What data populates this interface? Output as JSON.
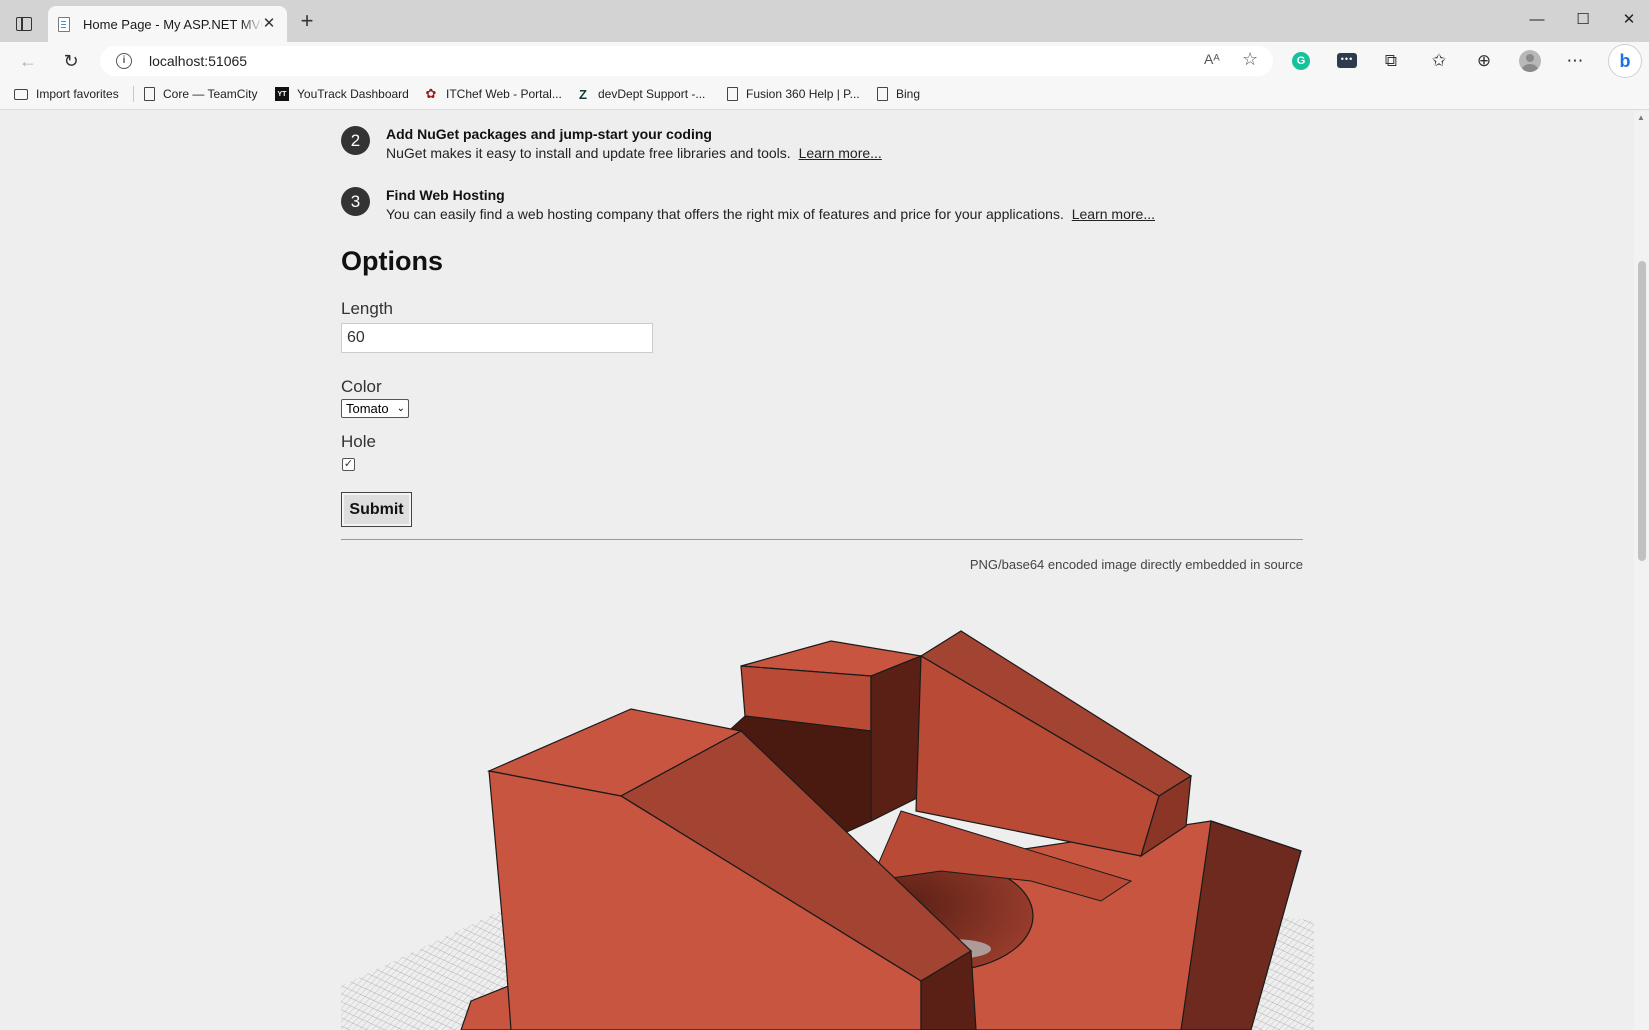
{
  "browser": {
    "tab_title": "Home Page - My ASP.NET MVC Application",
    "url": "localhost:51065",
    "bookmarks": [
      {
        "label": "Import favorites",
        "icon": "folder-icon"
      },
      {
        "label": "Core — TeamCity",
        "icon": "page-icon"
      },
      {
        "label": "YouTrack Dashboard",
        "icon": "youtrack-icon"
      },
      {
        "label": "ITChef Web - Portal...",
        "icon": "itchef-icon"
      },
      {
        "label": "devDept Support -...",
        "icon": "zendesk-icon"
      },
      {
        "label": "Fusion 360 Help | P...",
        "icon": "page-icon"
      },
      {
        "label": "Bing",
        "icon": "page-icon"
      }
    ]
  },
  "steps": [
    {
      "number": "2",
      "heading": "Add NuGet packages and jump-start your coding",
      "description": "NuGet makes it easy to install and update free libraries and tools.",
      "link": "Learn more..."
    },
    {
      "number": "3",
      "heading": "Find Web Hosting",
      "description": "You can easily find a web hosting company that offers the right mix of features and price for your applications.",
      "link": "Learn more..."
    }
  ],
  "options": {
    "title": "Options",
    "length_label": "Length",
    "length_value": "60",
    "color_label": "Color",
    "color_selected": "Tomato",
    "hole_label": "Hole",
    "hole_checked": true,
    "submit_label": "Submit"
  },
  "image_caption": "PNG/base64 encoded image directly embedded in source",
  "model_color": "#c8553f"
}
